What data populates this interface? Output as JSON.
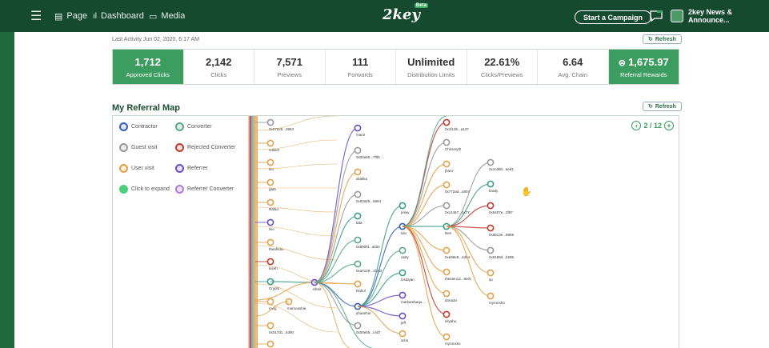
{
  "nav": {
    "page_label": "Page",
    "dashboard_label": "Dashboard",
    "media_label": "Media",
    "logo_text": "2key",
    "beta_badge": "Beta",
    "campaign_button": "Start a Campaign",
    "account_name": "2key News & Announce..."
  },
  "last_activity": "Last Activity Jun 02, 2020, 6:17 AM",
  "refresh_label": "Refresh",
  "stats": [
    {
      "value": "1,712",
      "label": "Approved Clicks",
      "highlight": true
    },
    {
      "value": "2,142",
      "label": "Clicks",
      "highlight": false
    },
    {
      "value": "7,571",
      "label": "Previews",
      "highlight": false
    },
    {
      "value": "111",
      "label": "Forwards",
      "highlight": false
    },
    {
      "value": "Unlimited",
      "label": "Distribution Limits",
      "highlight": false
    },
    {
      "value": "22.61%",
      "label": "Clicks/Previews",
      "highlight": false
    },
    {
      "value": "6.64",
      "label": "Avg. Chain",
      "highlight": false
    },
    {
      "value": "1,675.97",
      "label": "Referral Rewards",
      "highlight": true
    }
  ],
  "referral_map": {
    "title": "My Referral Map",
    "pager_text": "2 / 12",
    "legend": [
      {
        "label": "Contractor",
        "color": "#3b5db8"
      },
      {
        "label": "Converter",
        "color": "#5aa88a"
      },
      {
        "label": "Guest visit",
        "color": "#9a9a9a"
      },
      {
        "label": "Rejected Converter",
        "color": "#c0392b"
      },
      {
        "label": "User visit",
        "color": "#e0a24b"
      },
      {
        "label": "Referrer",
        "color": "#6a4fc2"
      },
      {
        "label": "Click to expand",
        "color": "#4cd17a"
      },
      {
        "label": "Referrer Converter",
        "color": "#b27ad6"
      }
    ],
    "nodes": {
      "col0": [
        "0x07625...3963",
        "Gilbert",
        "Ilia",
        "gata",
        "Rafao",
        "ilso",
        "theahsan",
        "bizeh",
        "Crypto",
        "mwg",
        "0x017d1...5390"
      ],
      "hub": "ellmit",
      "hub2": "mamoashie",
      "col2": [
        "mamt",
        "0x00a50...7f0b",
        "aliakka",
        "0x63a25...5864",
        "tata",
        "0x9b0fd...a03e",
        "0xa4129...1f4d2",
        "Rahul",
        "yhaanhur",
        "0x00eb5...c4d7"
      ],
      "col3": [
        "priwy",
        "lulu",
        "rasty",
        "lostdyan",
        "markambaqu...",
        "jeff",
        "arria"
      ],
      "col4": [
        "0x1f13b...a137",
        "Chrismyth",
        "jhanz",
        "0x772ad...a804",
        "0xc2467...4477",
        "Ren",
        "0xe99e8...4d94",
        "thesam12...9e0c",
        "donado",
        "eliyahu",
        "myronsko"
      ],
      "col5": [
        "0x1cd80...aed1",
        "brady",
        "0x5407e...3f87",
        "0x5613e...9969",
        "0x9189d...b285",
        "sp",
        "myronsho"
      ]
    }
  }
}
